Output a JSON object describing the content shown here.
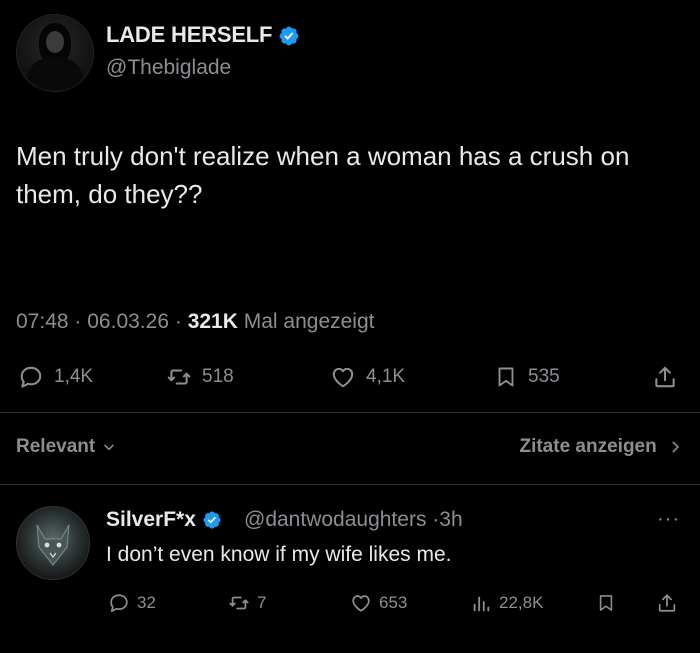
{
  "tweet": {
    "author_name": "LADE HERSELF",
    "author_handle": "@Thebiglade",
    "text": "Men truly don't realize when a woman has a crush on them, do they??",
    "time": "07:48",
    "sep1": "·",
    "date": "06.03.26",
    "sep2": "·",
    "views": "321K",
    "views_label": "Mal angezeigt",
    "stats": {
      "replies": "1,4K",
      "reposts": "518",
      "likes": "4,1K",
      "bookmarks": "535"
    }
  },
  "filter": {
    "relevant_label": "Relevant",
    "quotes_label": "Zitate anzeigen"
  },
  "reply": {
    "author_name": "SilverF*x",
    "author_handle": "@dantwodaughters",
    "sep": "·",
    "age": "3h",
    "more": "···",
    "text": "I don’t even know if my wife likes me.",
    "stats": {
      "replies": "32",
      "reposts": "7",
      "likes": "653",
      "views": "22,8K"
    }
  },
  "colors": {
    "background": "#000000",
    "text": "#e7e9ea",
    "muted": "#8b8f94",
    "verified": "#1d9bf0"
  },
  "icons": [
    "verified-badge-icon",
    "reply-icon",
    "repost-icon",
    "like-icon",
    "bookmark-icon",
    "share-icon",
    "views-icon",
    "chevron-down-icon",
    "chevron-right-icon"
  ]
}
